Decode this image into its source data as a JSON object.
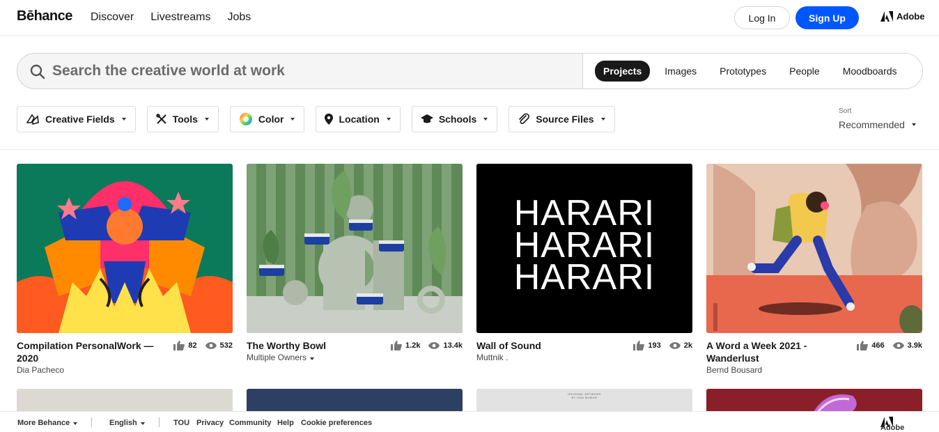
{
  "nav": {
    "logo": "Bēhance",
    "links": [
      "Discover",
      "Livestreams",
      "Jobs"
    ],
    "login": "Log In",
    "signup": "Sign Up",
    "adobe": "Adobe"
  },
  "search": {
    "placeholder": "Search the creative world at work",
    "tabs": [
      "Projects",
      "Images",
      "Prototypes",
      "People",
      "Moodboards"
    ],
    "active_tab": "Projects"
  },
  "filters": [
    {
      "label": "Creative Fields",
      "icon": "creative-fields-icon"
    },
    {
      "label": "Tools",
      "icon": "tools-icon"
    },
    {
      "label": "Color",
      "icon": "color-wheel-icon"
    },
    {
      "label": "Location",
      "icon": "location-pin-icon"
    },
    {
      "label": "Schools",
      "icon": "graduation-cap-icon"
    },
    {
      "label": "Source Files",
      "icon": "paperclip-icon"
    }
  ],
  "sort": {
    "label": "Sort",
    "value": "Recommended"
  },
  "projects": [
    {
      "title": "Compilation PersonalWork — 2020",
      "owner": "Dia Pacheco",
      "likes": "82",
      "views": "532"
    },
    {
      "title": "The Worthy Bowl",
      "owner": "Multiple Owners",
      "likes": "1.2k",
      "views": "13.4k"
    },
    {
      "title": "Wall of Sound",
      "owner": "Muttnik .",
      "likes": "193",
      "views": "2k",
      "thumb_text": [
        "HARARI",
        "HARARI",
        "HARARI"
      ]
    },
    {
      "title": "A Word a Week 2021 - Wanderlust",
      "owner": "Bernd Bousard",
      "likes": "466",
      "views": "3.9k"
    }
  ],
  "row2_text": {
    "card3_caption_1": "ORIGINAL ARTWORK",
    "card3_caption_2": "BY DAN MUMAR"
  },
  "footer": {
    "more": "More Behance",
    "language": "English",
    "links": [
      "TOU",
      "Privacy",
      "Community",
      "Help",
      "Cookie preferences"
    ],
    "adobe": "Adobe"
  },
  "colors": {
    "accent": "#0057ff",
    "text": "#191919"
  }
}
